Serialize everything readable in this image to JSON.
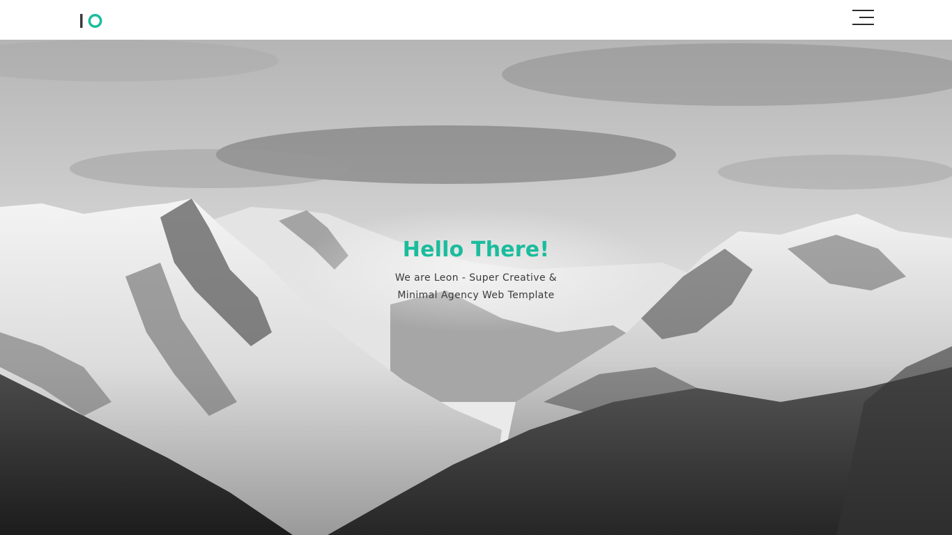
{
  "header": {
    "logo_text": "IO",
    "menu_icon": "hamburger-menu-icon"
  },
  "hero": {
    "title": "Hello There!",
    "subtitle": "We are Leon - Super Creative & Minimal Agency Web Template",
    "background": "snowy-mountains-grayscale-photo"
  },
  "colors": {
    "accent": "#1abc9c",
    "text_dark": "#3a3a3a",
    "header_bg": "#ffffff"
  }
}
